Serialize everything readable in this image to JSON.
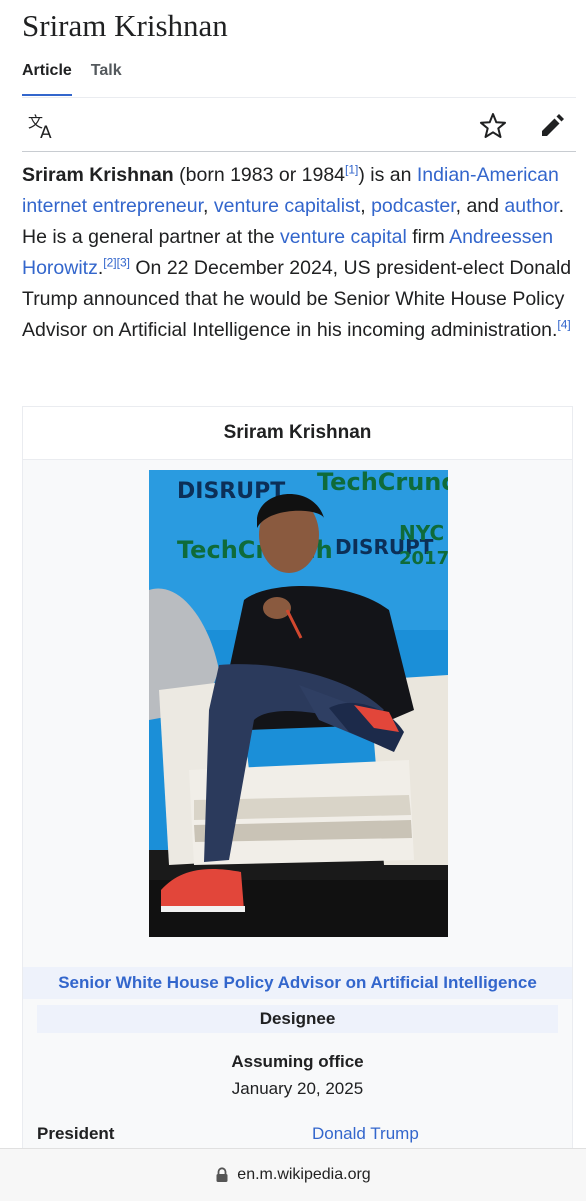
{
  "page_title": "Sriram Krishnan",
  "tabs": [
    {
      "label": "Article",
      "active": true
    },
    {
      "label": "Talk",
      "active": false
    }
  ],
  "toolbar": {
    "language_icon": "translate-icon",
    "watch_icon": "star-icon",
    "edit_icon": "pencil-icon"
  },
  "intro": {
    "subject": "Sriram Krishnan",
    "t1": " (born 1983 or 1984",
    "ref1": "[1]",
    "t2": ") is an ",
    "link_indian_american": "Indian-American",
    "t3": " ",
    "link_internet_entrepreneur": "internet entrepreneur",
    "t4": ", ",
    "link_venture_capitalist": "venture capitalist",
    "t5": ", ",
    "link_podcaster": "podcaster",
    "t6": ", and ",
    "link_author": "author",
    "t7": ". He is a general partner at the ",
    "link_venture_capital": "venture capital",
    "t8": " firm ",
    "link_a16z": "Andreessen Horowitz",
    "t9": ".",
    "ref2": "[2]",
    "ref3": "[3]",
    "t10": " On 22 December 2024, US president-elect Donald Trump announced that he would be Senior White House Policy Advisor on Artificial Intelligence in his incoming administration.",
    "ref4": "[4]"
  },
  "infobox": {
    "name": "Sriram Krishnan",
    "image_signage": {
      "disrupt": "DISRUPT",
      "techcrunch": "TechCrunch",
      "nyc": "NYC",
      "year": "2017"
    },
    "office": "Senior White House Policy Advisor on Artificial Intelligence",
    "status": "Designee",
    "assuming_label": "Assuming office",
    "assuming_date": "January 20, 2025",
    "president_label": "President",
    "president_value": "Donald Trump"
  },
  "url_bar": {
    "icon": "lock-icon",
    "url": "en.m.wikipedia.org"
  },
  "colors": {
    "link": "#3366cc",
    "text": "#202122",
    "muted": "#54595d"
  }
}
